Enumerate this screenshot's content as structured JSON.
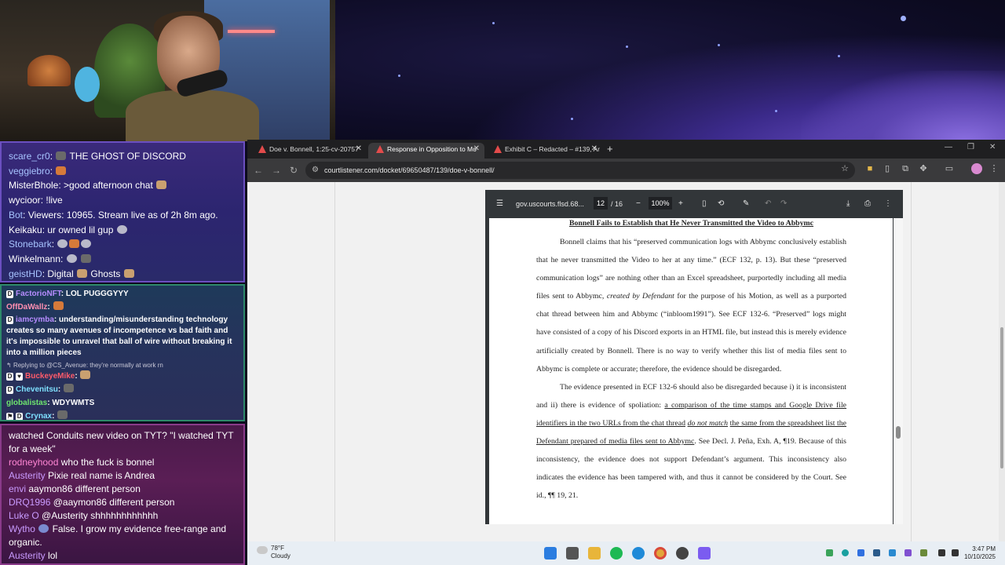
{
  "chat_top": [
    {
      "user": "scare_cr0",
      "text": "THE GHOST OF DISCORD",
      "emotes": 1
    },
    {
      "user": "veggiebro",
      "text": "",
      "emotes": 1
    },
    {
      "user": "MisterBhole",
      "text": ">good afternoon chat",
      "emotes": 1
    },
    {
      "user": "wycioor",
      "text": "!live",
      "emotes": 0
    },
    {
      "user": "Bot",
      "text": "Viewers: 10965. Stream live as of 2h 8m ago.",
      "emotes": 0
    },
    {
      "user": "Keikaku",
      "text": "ur owned lil gup",
      "emotes": 1
    },
    {
      "user": "Stonebark",
      "text": "",
      "emotes": 3
    },
    {
      "user": "Winkelmann",
      "text": "",
      "emotes": 2
    },
    {
      "user": "geistHD",
      "text": "Digital",
      "text2": "Ghosts",
      "emotes": 2
    }
  ],
  "chat_mid": [
    {
      "user": "FactorioNFT",
      "text": "LOL PUGGGYYY"
    },
    {
      "user": "OffDaWallz",
      "text": ""
    },
    {
      "user": "iamcymba",
      "text": "understanding/misunderstanding technology creates so many avenues of incompetence vs bad faith and it's impossible to unravel that ball of wire without breaking it into a million pieces"
    },
    {
      "reply": "Replying to @CS_Avenue: they're normally at work rn"
    },
    {
      "user": "BuckeyeMike",
      "text": ""
    },
    {
      "user": "Chevenitsu",
      "text": ""
    },
    {
      "user": "globalistas",
      "text": "WDYWMTS"
    },
    {
      "user": "Crynax",
      "text": ""
    }
  ],
  "chat_bottom": [
    {
      "user": "",
      "text": "watched Conduits new video on TYT? \"I watched TYT for a week\""
    },
    {
      "user": "rodneyhood",
      "text": "who the fuck is bonnel"
    },
    {
      "user": "Austerity",
      "text": "Pixie real name is Andrea"
    },
    {
      "user": "envi",
      "text": "aaymon86 different person"
    },
    {
      "user": "DRQ1996",
      "text": "@aaymon86 different person"
    },
    {
      "user": "Luke O",
      "text": "@Austerity shhhhhhhhhhhh"
    },
    {
      "user": "Wytho",
      "text": "False. I grow my evidence free-range and organic."
    },
    {
      "user": "Austerity",
      "text": "lol"
    }
  ],
  "browser": {
    "tabs": [
      {
        "label": "Doe v. Bonnell, 1:25-cv-20757",
        "active": false
      },
      {
        "label": "Response in Opposition to Mo",
        "active": true
      },
      {
        "label": "Exhibit C – Redacted – #139, Ar",
        "active": false
      }
    ],
    "url": "courtlistener.com/docket/69650487/139/doe-v-bonnell/"
  },
  "pdf": {
    "filename": "gov.uscourts.flsd.68...",
    "page_current": "12",
    "page_total": "/ 16",
    "zoom": "100%",
    "heading": "Bonnell Fails to Establish that He Never Transmitted the Video to Abbymc",
    "p1": "Bonnell claims that his “preserved communication logs with Abbymc conclusively establish that he never transmitted the Video to her at any time.” (ECF 132, p. 13). But these “preserved communication logs” are nothing other than an Excel spreadsheet, purportedly including all media files sent to Abbymc,",
    "p1_italic": "created by Defendant",
    "p1_cont": "for the purpose of his Motion, as well as a purported chat thread between him and Abbymc (“inbloom1991”). See ECF 132-6. “Preserved” logs might have consisted of a copy of his Discord exports in an HTML file, but instead this is merely evidence artificially created by Bonnell.  There is no way to verify whether this list of media files sent to Abbymc is complete or accurate; therefore, the evidence should be disregarded.",
    "p2_start": "The evidence presented in ECF 132-6 should also be disregarded because i) it is inconsistent and ii) there is evidence of spoliation:",
    "p2_underline_a": "a comparison of the time stamps and Google Drive file identifiers in the two URLs from the chat thread",
    "p2_underline_italic": "do not match",
    "p2_underline_b": "the same from the spreadsheet list the Defendant prepared of media files sent to Abbymc",
    "p2_end": ". See Decl. J. Peña, Exh. A, ¶19. Because of this inconsistency, the evidence does not support Defendant’s argument. This inconsistency also indicates the evidence has been tampered with, and thus it cannot be considered by the Court. See id., ¶¶ 19, 21."
  },
  "taskbar": {
    "temp": "78°F",
    "condition": "Cloudy",
    "time": "3:47 PM",
    "date": "10/10/2025"
  }
}
